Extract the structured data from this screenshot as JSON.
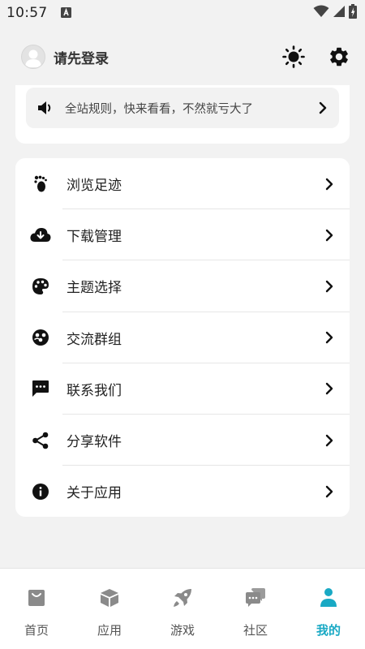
{
  "status": {
    "time": "10:57"
  },
  "header": {
    "login_text": "请先登录"
  },
  "notice": {
    "text": "全站规则，快来看看，不然就亏大了"
  },
  "menu": [
    {
      "label": "浏览足迹",
      "icon": "footprint-icon"
    },
    {
      "label": "下载管理",
      "icon": "cloud-download-icon"
    },
    {
      "label": "主题选择",
      "icon": "palette-icon"
    },
    {
      "label": "交流群组",
      "icon": "group-icon"
    },
    {
      "label": "联系我们",
      "icon": "message-icon"
    },
    {
      "label": "分享软件",
      "icon": "share-icon"
    },
    {
      "label": "关于应用",
      "icon": "info-icon"
    }
  ],
  "tabs": [
    {
      "label": "首页",
      "icon": "home-bag-icon",
      "active": false
    },
    {
      "label": "应用",
      "icon": "box-icon",
      "active": false
    },
    {
      "label": "游戏",
      "icon": "rocket-icon",
      "active": false
    },
    {
      "label": "社区",
      "icon": "chat-icon",
      "active": false
    },
    {
      "label": "我的",
      "icon": "person-icon",
      "active": true
    }
  ],
  "colors": {
    "accent": "#19a9c4",
    "inactive_icon": "#8a8a8a",
    "background": "#f2f2f2"
  }
}
